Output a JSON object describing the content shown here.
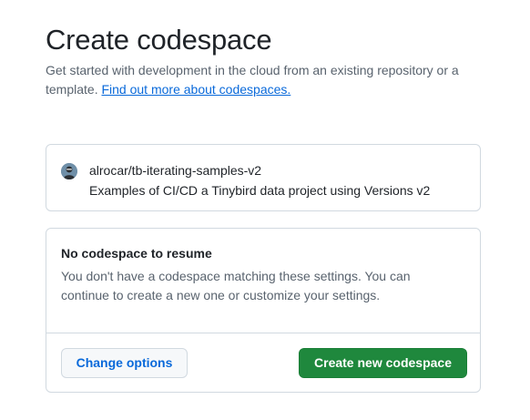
{
  "header": {
    "title": "Create codespace",
    "subtitle": "Get started with development in the cloud from an existing repository or a template.",
    "learn_more_link": "Find out more about codespaces."
  },
  "repository": {
    "avatar_icon": "user-avatar-icon",
    "name": "alrocar/tb-iterating-samples-v2",
    "description": "Examples of CI/CD a Tinybird data project using Versions v2"
  },
  "resume": {
    "heading": "No codespace to resume",
    "message": "You don't have a codespace matching these settings. You can continue to create a new one or customize your settings.",
    "change_options_label": "Change options",
    "create_label": "Create new codespace"
  },
  "colors": {
    "link": "#0969da",
    "primary_button": "#1f883d",
    "muted_text": "#59636e",
    "border": "#d1d9e0"
  }
}
